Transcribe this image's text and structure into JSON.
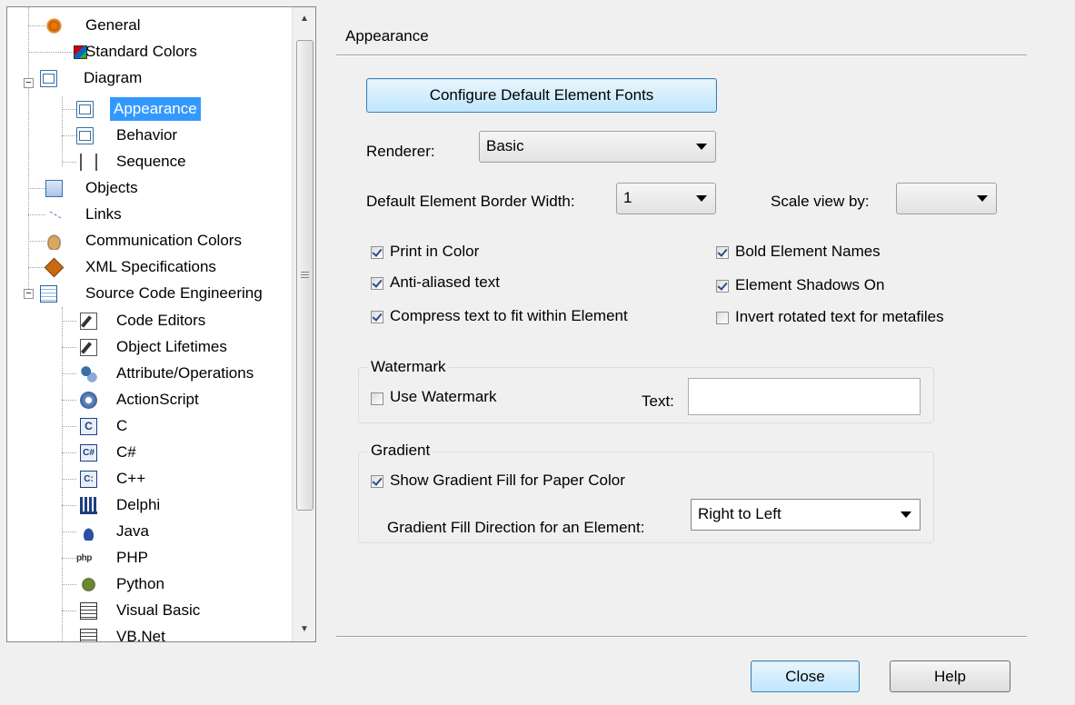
{
  "tree": {
    "items": [
      {
        "label": "General",
        "icon": "gear-icon"
      },
      {
        "label": "Standard Colors",
        "icon": "colors-icon"
      },
      {
        "label": "Diagram",
        "icon": "diagram-icon"
      },
      {
        "label": "Appearance",
        "icon": "diagram-icon",
        "selected": true
      },
      {
        "label": "Behavior",
        "icon": "diagram-icon"
      },
      {
        "label": "Sequence",
        "icon": "sequence-icon"
      },
      {
        "label": "Objects",
        "icon": "objects-icon"
      },
      {
        "label": "Links",
        "icon": "links-icon"
      },
      {
        "label": "Communication Colors",
        "icon": "communication-icon"
      },
      {
        "label": "XML Specifications",
        "icon": "xml-icon"
      },
      {
        "label": "Source Code Engineering",
        "icon": "source-code-icon"
      },
      {
        "label": "Code Editors",
        "icon": "editor-icon"
      },
      {
        "label": "Object Lifetimes",
        "icon": "editor-icon"
      },
      {
        "label": "Attribute/Operations",
        "icon": "attribute-icon"
      },
      {
        "label": "ActionScript",
        "icon": "actionscript-icon"
      },
      {
        "label": "C",
        "icon": "c-language-icon",
        "glyph": "C"
      },
      {
        "label": "C#",
        "icon": "csharp-icon",
        "glyph": "C#"
      },
      {
        "label": "C++",
        "icon": "cpp-icon",
        "glyph": "C:"
      },
      {
        "label": "Delphi",
        "icon": "delphi-icon"
      },
      {
        "label": "Java",
        "icon": "java-icon"
      },
      {
        "label": "PHP",
        "icon": "php-icon",
        "glyph": "php"
      },
      {
        "label": "Python",
        "icon": "python-icon"
      },
      {
        "label": "Visual Basic",
        "icon": "visual-basic-icon"
      },
      {
        "label": "VB.Net",
        "icon": "vbnet-icon"
      }
    ],
    "expander_symbol": "−"
  },
  "section_title": "Appearance",
  "configure_fonts_label": "Configure Default Element Fonts",
  "renderer": {
    "label": "Renderer:",
    "value": "Basic"
  },
  "border_width": {
    "label": "Default Element Border Width:",
    "value": "1"
  },
  "scale_view": {
    "label": "Scale view by:",
    "value": ""
  },
  "checkboxes": {
    "print_color": {
      "label": "Print in Color",
      "checked": true
    },
    "anti_aliased": {
      "label": "Anti-aliased text",
      "checked": true
    },
    "compress_text": {
      "label": "Compress text to fit within Element",
      "checked": true
    },
    "bold_names": {
      "label": "Bold Element Names",
      "checked": true
    },
    "shadows": {
      "label": "Element Shadows On",
      "checked": true
    },
    "invert_rotated": {
      "label": "Invert rotated text for metafiles",
      "checked": false
    }
  },
  "watermark": {
    "title": "Watermark",
    "use_label": "Use Watermark",
    "use_checked": false,
    "text_label": "Text:",
    "text_value": ""
  },
  "gradient": {
    "title": "Gradient",
    "show_label": "Show Gradient Fill for Paper Color",
    "show_checked": true,
    "direction_label": "Gradient Fill Direction for an Element:",
    "direction_value": "Right to Left"
  },
  "buttons": {
    "close": "Close",
    "help": "Help"
  }
}
